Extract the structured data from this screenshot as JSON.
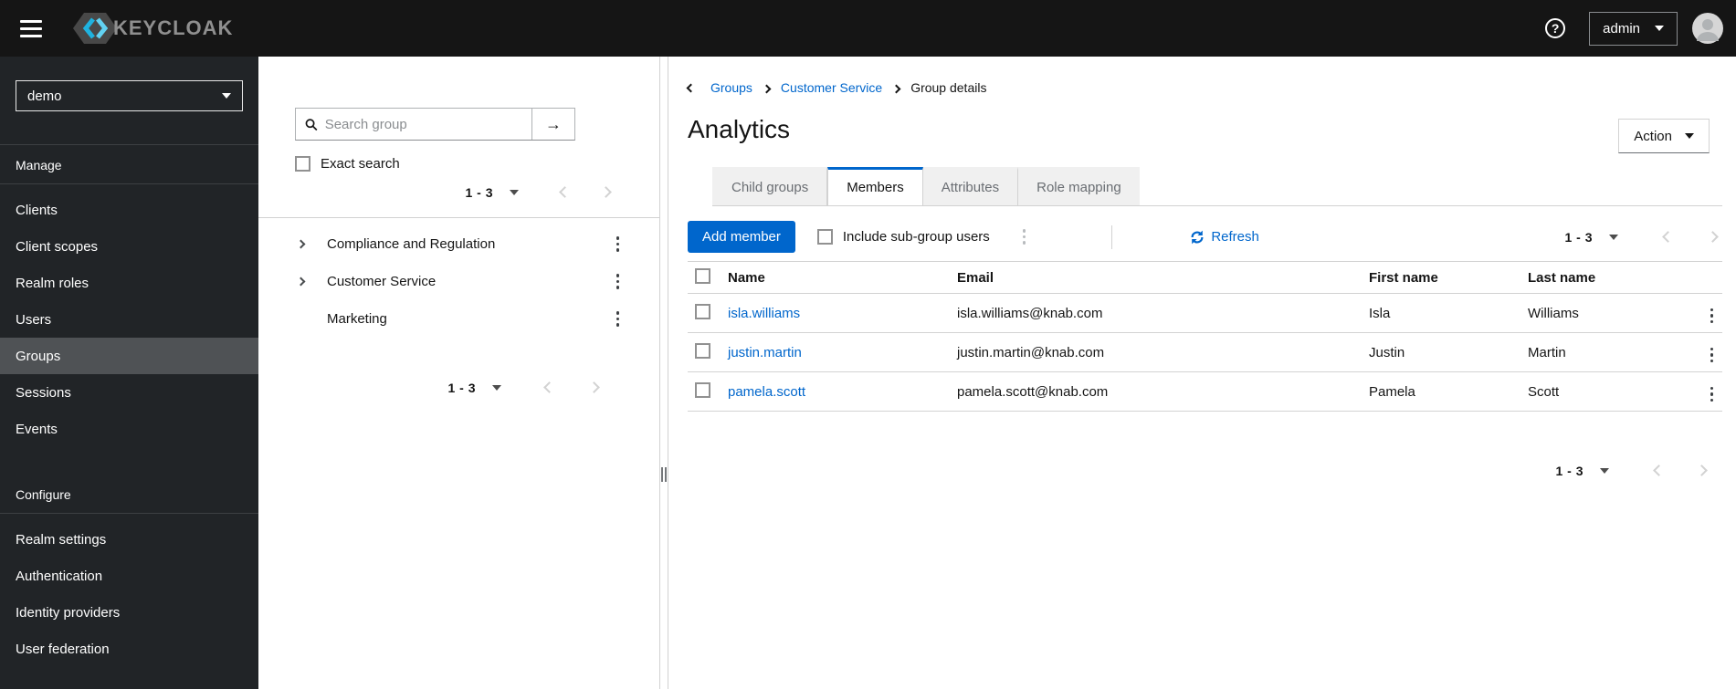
{
  "masthead": {
    "brand": "KEYCLOAK",
    "user": "admin"
  },
  "icons": {
    "help": "?",
    "arrow_right": "→"
  },
  "sidebar": {
    "realm": "demo",
    "sections": [
      {
        "label": "Manage",
        "items": [
          {
            "label": "Clients",
            "active": false
          },
          {
            "label": "Client scopes",
            "active": false
          },
          {
            "label": "Realm roles",
            "active": false
          },
          {
            "label": "Users",
            "active": false
          },
          {
            "label": "Groups",
            "active": true
          },
          {
            "label": "Sessions",
            "active": false
          },
          {
            "label": "Events",
            "active": false
          }
        ]
      },
      {
        "label": "Configure",
        "items": [
          {
            "label": "Realm settings",
            "active": false
          },
          {
            "label": "Authentication",
            "active": false
          },
          {
            "label": "Identity providers",
            "active": false
          },
          {
            "label": "User federation",
            "active": false
          }
        ]
      }
    ]
  },
  "tree_panel": {
    "search_placeholder": "Search group",
    "exact_search_label": "Exact search",
    "top_pagination": {
      "range": "1 - 3"
    },
    "groups": [
      {
        "label": "Compliance and Regulation",
        "expandable": true
      },
      {
        "label": "Customer Service",
        "expandable": true
      },
      {
        "label": "Marketing",
        "expandable": false
      }
    ],
    "bottom_pagination": {
      "range": "1 - 3"
    }
  },
  "main": {
    "breadcrumb": {
      "items": [
        "Groups",
        "Customer Service",
        "Group details"
      ]
    },
    "title": "Analytics",
    "action_button": "Action",
    "tabs": [
      {
        "label": "Child groups"
      },
      {
        "label": "Members"
      },
      {
        "label": "Attributes"
      },
      {
        "label": "Role mapping"
      }
    ],
    "toolbar": {
      "add_member_label": "Add member",
      "include_subgroups_label": "Include sub-group users",
      "refresh_label": "Refresh",
      "pagination": {
        "range": "1 - 3"
      }
    },
    "table": {
      "headers": [
        "Name",
        "Email",
        "First name",
        "Last name"
      ],
      "rows": [
        {
          "name": "isla.williams",
          "email": "isla.williams@knab.com",
          "first_name": "Isla",
          "last_name": "Williams"
        },
        {
          "name": "justin.martin",
          "email": "justin.martin@knab.com",
          "first_name": "Justin",
          "last_name": "Martin"
        },
        {
          "name": "pamela.scott",
          "email": "pamela.scott@knab.com",
          "first_name": "Pamela",
          "last_name": "Scott"
        }
      ]
    },
    "bottom_pagination": {
      "range": "1 - 3"
    }
  },
  "colors": {
    "accent": "#0066cc",
    "link": "#0066cc",
    "masthead_bg": "#151515",
    "sidebar_bg": "#212427",
    "sidebar_active_bg": "#4f5255",
    "border": "#d2d2d2",
    "muted_text": "#6a6e73",
    "tab_inactive_bg": "#f0f0f0"
  }
}
